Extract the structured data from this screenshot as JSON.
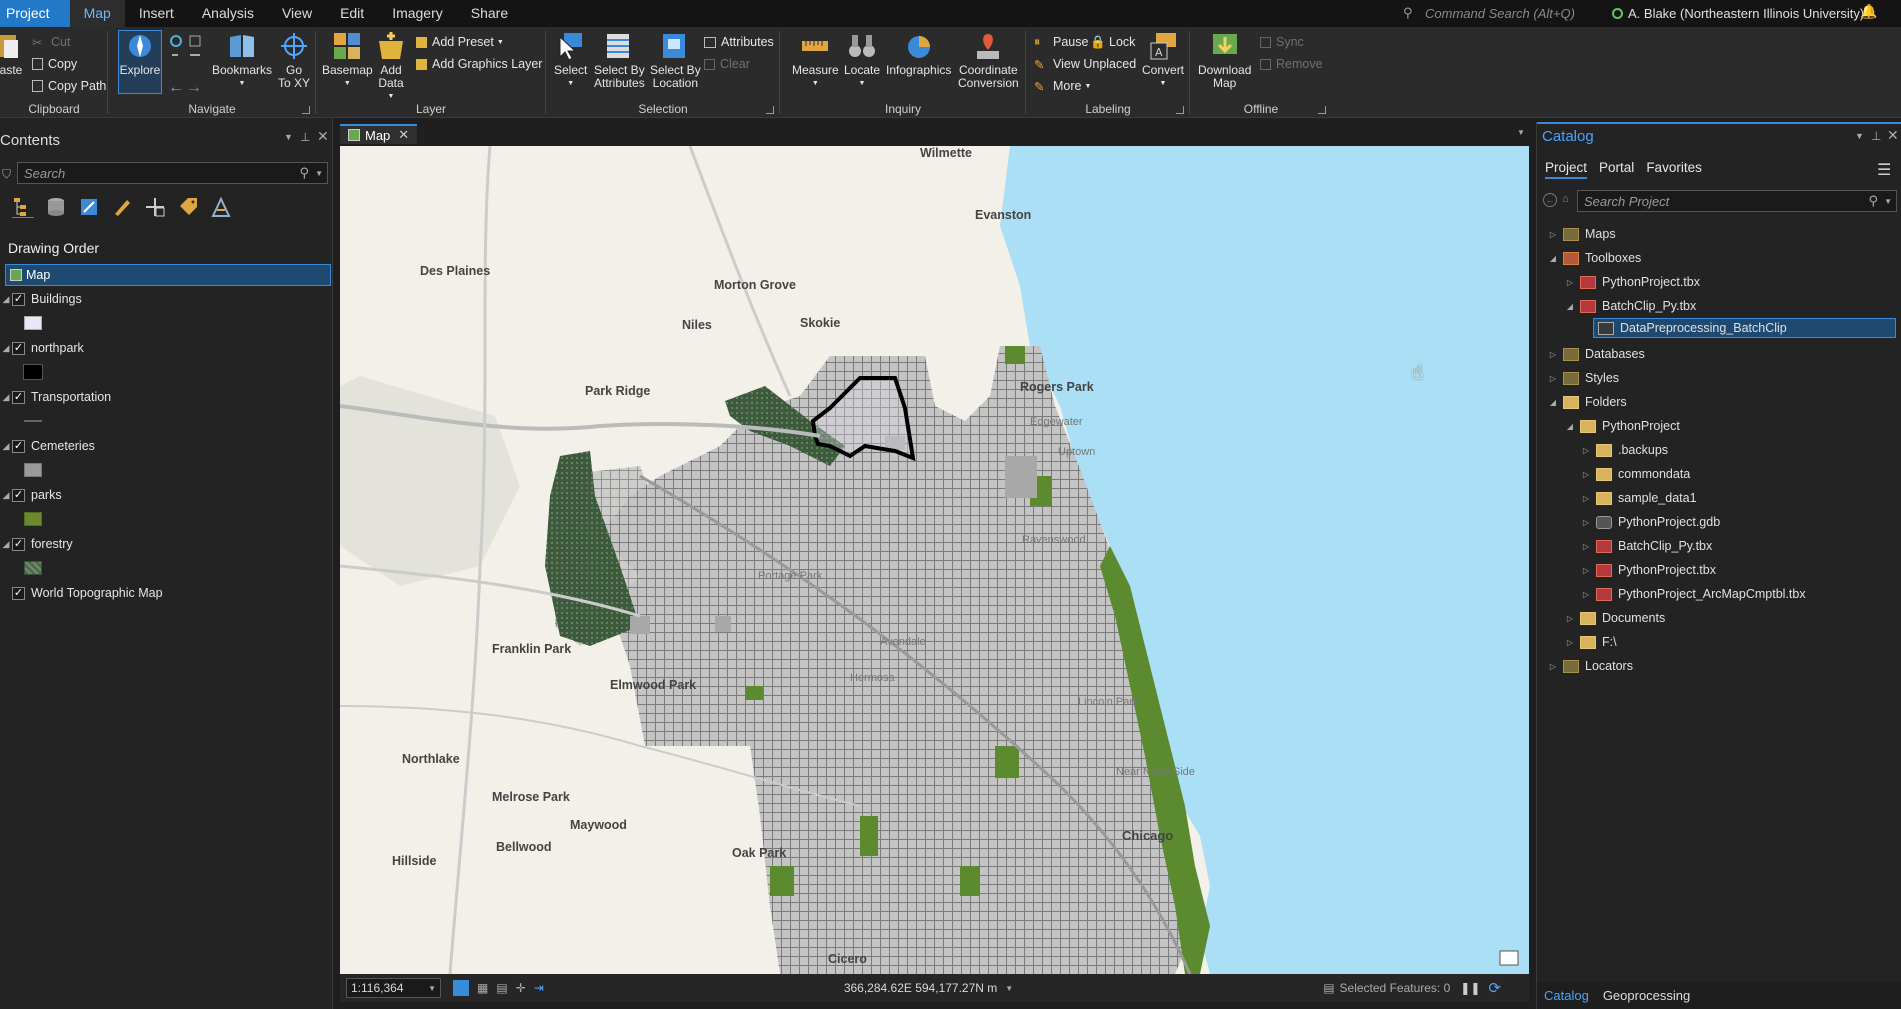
{
  "tabs": [
    {
      "label": "Project"
    },
    {
      "label": "Map"
    },
    {
      "label": "Insert"
    },
    {
      "label": "Analysis"
    },
    {
      "label": "View"
    },
    {
      "label": "Edit"
    },
    {
      "label": "Imagery"
    },
    {
      "label": "Share"
    }
  ],
  "command_search": {
    "placeholder": "Command Search (Alt+Q)"
  },
  "user": {
    "name": "A. Blake (Northeastern Illinois University)"
  },
  "ribbon": {
    "clipboard": {
      "label": "Clipboard",
      "paste": "aste",
      "cut": "Cut",
      "copy": "Copy",
      "copy_path": "Copy Path"
    },
    "navigate": {
      "label": "Navigate",
      "explore": "Explore",
      "bookmarks": "Bookmarks",
      "go_to_xy": "Go\nTo XY"
    },
    "layer": {
      "label": "Layer",
      "basemap": "Basemap",
      "add_data": "Add\nData",
      "add_preset": "Add Preset",
      "add_graphics_layer": "Add Graphics Layer"
    },
    "selection": {
      "label": "Selection",
      "select": "Select",
      "select_by_attributes": "Select By\nAttributes",
      "select_by_location": "Select By\nLocation",
      "attributes": "Attributes",
      "clear": "Clear"
    },
    "inquiry": {
      "label": "Inquiry",
      "measure": "Measure",
      "locate": "Locate",
      "infographics": "Infographics",
      "coordinate_conversion": "Coordinate\nConversion"
    },
    "labeling": {
      "label": "Labeling",
      "pause": "Pause",
      "lock": "Lock",
      "view_unplaced": "View Unplaced",
      "more": "More",
      "convert": "Convert"
    },
    "offline": {
      "label": "Offline",
      "download_map": "Download\nMap",
      "sync": "Sync",
      "remove": "Remove"
    }
  },
  "contents": {
    "title": "Contents",
    "search_placeholder": "Search",
    "drawing_order": "Drawing Order",
    "map_label": "Map",
    "layers": [
      {
        "name": "Buildings",
        "swatch": "#ece4f7"
      },
      {
        "name": "northpark",
        "swatch": "#000000"
      },
      {
        "name": "Transportation",
        "swatch": "#666666"
      },
      {
        "name": "Cemeteries",
        "swatch": "#9a9a9a"
      },
      {
        "name": "parks",
        "swatch": "#6b8a2e"
      },
      {
        "name": "forestry",
        "swatch": "#4d6a4a"
      },
      {
        "name": "World Topographic Map",
        "swatch": ""
      }
    ]
  },
  "map": {
    "tab_label": "Map",
    "place_labels": [
      "Wilmette",
      "Evanston",
      "Des Plaines",
      "Morton Grove",
      "Skokie",
      "Niles",
      "Park Ridge",
      "Rogers Park",
      "Franklin Park",
      "Elmwood Park",
      "Northlake",
      "Melrose Park",
      "Maywood",
      "Bellwood",
      "Hillside",
      "Oak Park",
      "Cicero",
      "Chicago",
      "Near North Side",
      "Uptown",
      "Edgewater",
      "Lincoln Park",
      "Avondale",
      "Hermosa",
      "Portage Park",
      "Ravenswood"
    ],
    "scale": "1:116,364",
    "coords": "366,284.62E 594,177.27N m",
    "selected_features": "Selected Features: 0"
  },
  "catalog": {
    "title": "Catalog",
    "tabs": [
      "Project",
      "Portal",
      "Favorites"
    ],
    "search_placeholder": "Search Project",
    "tree": [
      {
        "label": "Maps"
      },
      {
        "label": "Toolboxes"
      },
      {
        "label": "PythonProject.tbx"
      },
      {
        "label": "BatchClip_Py.tbx"
      },
      {
        "label": "DataPreprocessing_BatchClip"
      },
      {
        "label": "Databases"
      },
      {
        "label": "Styles"
      },
      {
        "label": "Folders"
      },
      {
        "label": "PythonProject"
      },
      {
        "label": ".backups"
      },
      {
        "label": "commondata"
      },
      {
        "label": "sample_data1"
      },
      {
        "label": "PythonProject.gdb"
      },
      {
        "label": "BatchClip_Py.tbx"
      },
      {
        "label": "PythonProject.tbx"
      },
      {
        "label": "PythonProject_ArcMapCmptbl.tbx"
      },
      {
        "label": "Documents"
      },
      {
        "label": "F:\\"
      },
      {
        "label": "Locators"
      }
    ],
    "bottom_tabs": [
      "Catalog",
      "Geoprocessing"
    ]
  },
  "colors": {
    "accent": "#2279c8",
    "selection": "#1e4a72",
    "water": "#aadff5",
    "park": "#5c8a2e",
    "forest": "#3f5d3f"
  }
}
